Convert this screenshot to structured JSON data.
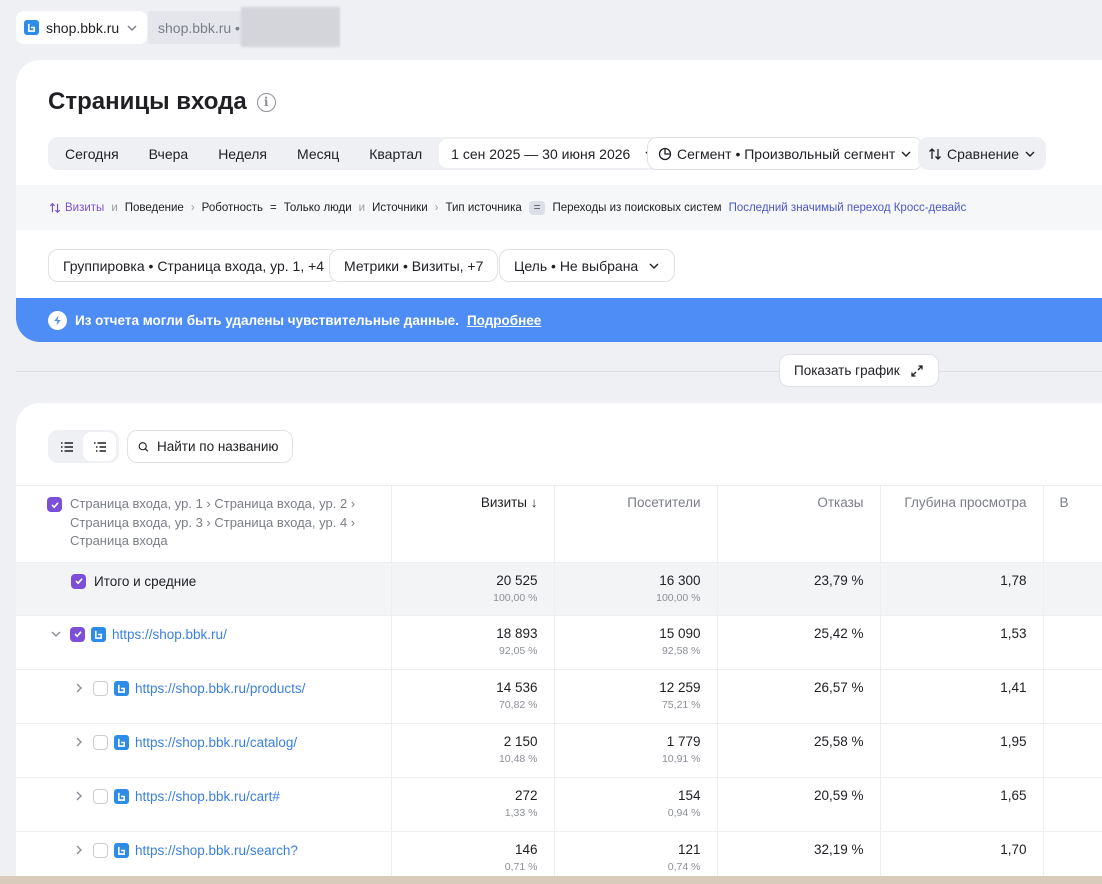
{
  "topbar": {
    "site_name": "shop.bbk.ru",
    "crumb": "shop.bbk.ru •"
  },
  "header": {
    "title": "Страницы входа",
    "periods": [
      "Сегодня",
      "Вчера",
      "Неделя",
      "Месяц",
      "Квартал"
    ],
    "date_range": "1 сен 2025 — 30 июня 2026",
    "segment": "Сегмент • Произвольный сегмент",
    "compare": "Сравнение"
  },
  "filters": {
    "visits": "Визиты",
    "and1": "и",
    "behavior": "Поведение",
    "robotness": "Роботность",
    "eq1": "=",
    "only_people": "Только люди",
    "and2": "и",
    "sources": "Источники",
    "source_type": "Тип источника",
    "eq2": "=",
    "search_traffic": "Переходы из поисковых систем",
    "last_click": "Последний значимый переход Кросс-девайс"
  },
  "controls": {
    "grouping": "Группировка • Страница входа, ур. 1, +4",
    "metrics": "Метрики • Визиты, +7",
    "goal": "Цель • Не выбрана"
  },
  "banner": {
    "text": "Из отчета могли быть удалены чувствительные данные.",
    "link": "Подробнее"
  },
  "chart_button": "Показать график",
  "search": {
    "placeholder": "Найти по названию"
  },
  "table": {
    "dimension_header": "Страница входа, ур. 1 › Страница входа, ур. 2 › Страница входа, ур. 3 › Страница входа, ур. 4 › Страница входа",
    "columns": [
      "Визиты ↓",
      "Посетители",
      "Отказы",
      "Глубина просмотра",
      "В"
    ],
    "total": {
      "label": "Итого и средние",
      "visits": "20 525",
      "visits_pct": "100,00 %",
      "visitors": "16 300",
      "visitors_pct": "100,00 %",
      "bounce": "23,79 %",
      "depth": "1,78"
    },
    "rows": [
      {
        "url": "https://shop.bbk.ru/",
        "visits": "18 893",
        "visits_pct": "92,05 %",
        "visitors": "15 090",
        "visitors_pct": "92,58 %",
        "bounce": "25,42 %",
        "depth": "1,53"
      },
      {
        "url": "https://shop.bbk.ru/products/",
        "visits": "14 536",
        "visits_pct": "70,82 %",
        "visitors": "12 259",
        "visitors_pct": "75,21 %",
        "bounce": "26,57 %",
        "depth": "1,41"
      },
      {
        "url": "https://shop.bbk.ru/catalog/",
        "visits": "2 150",
        "visits_pct": "10,48 %",
        "visitors": "1 779",
        "visitors_pct": "10,91 %",
        "bounce": "25,58 %",
        "depth": "1,95"
      },
      {
        "url": "https://shop.bbk.ru/cart#",
        "visits": "272",
        "visits_pct": "1,33 %",
        "visitors": "154",
        "visitors_pct": "0,94 %",
        "bounce": "20,59 %",
        "depth": "1,65"
      },
      {
        "url": "https://shop.bbk.ru/search?",
        "visits": "146",
        "visits_pct": "0,71 %",
        "visitors": "121",
        "visitors_pct": "0,74 %",
        "bounce": "32,19 %",
        "depth": "1,70"
      }
    ]
  }
}
